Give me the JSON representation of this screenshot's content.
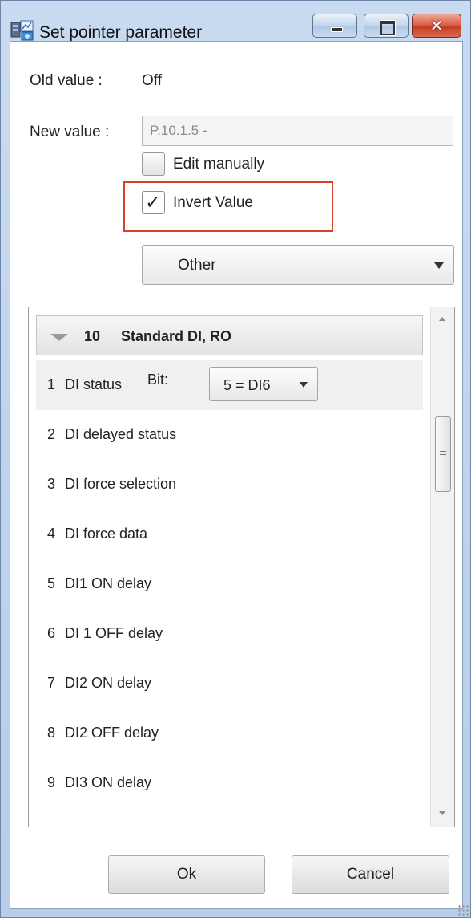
{
  "window": {
    "title": "Set pointer parameter",
    "close_glyph": "✕"
  },
  "form": {
    "old_value_label": "Old value :",
    "old_value": "Off",
    "new_value_label": "New value :",
    "new_value": "P.10.1.5 -",
    "edit_manually_label": "Edit manually",
    "edit_manually_checked": false,
    "invert_value_label": "Invert Value",
    "invert_value_checked": true,
    "invert_checkmark": "✓",
    "category_selected": "Other"
  },
  "list": {
    "group": {
      "number": "10",
      "name": "Standard DI, RO",
      "expanded": true
    },
    "bit_label": "Bit:",
    "bit_selected": "5 = DI6",
    "items": [
      {
        "num": "1",
        "label": "DI status"
      },
      {
        "num": "2",
        "label": "DI delayed status"
      },
      {
        "num": "3",
        "label": "DI force selection"
      },
      {
        "num": "4",
        "label": "DI force data"
      },
      {
        "num": "5",
        "label": "DI1 ON delay"
      },
      {
        "num": "6",
        "label": "DI 1 OFF delay"
      },
      {
        "num": "7",
        "label": "DI2 ON delay"
      },
      {
        "num": "8",
        "label": "DI2 OFF delay"
      },
      {
        "num": "9",
        "label": "DI3 ON delay"
      }
    ]
  },
  "buttons": {
    "ok": "Ok",
    "cancel": "Cancel"
  },
  "colors": {
    "highlight_border": "#d9412a",
    "title_bar": "#c8dbf0"
  }
}
